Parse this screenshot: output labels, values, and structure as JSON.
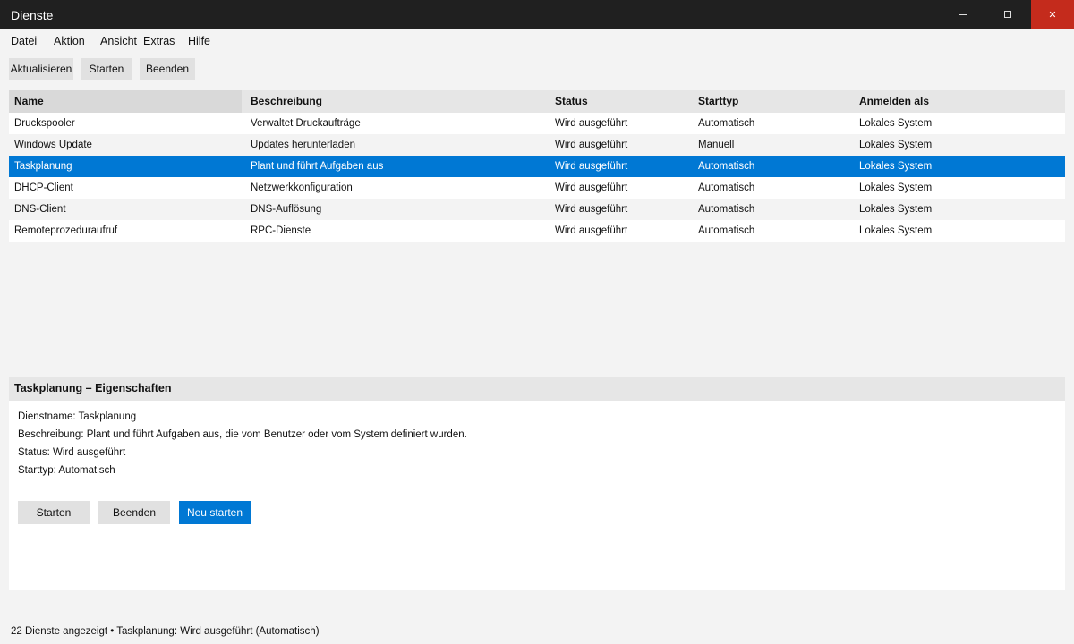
{
  "window": {
    "title": "Dienste",
    "minimize_icon": "minimize-icon",
    "maximize_icon": "maximize-icon",
    "close_glyph": "✕"
  },
  "menu": [
    "Datei",
    "Aktion",
    "Ansicht",
    "Extras",
    "Hilfe"
  ],
  "toolbar": {
    "refresh_label": "Aktualisieren",
    "start_label": "Starten",
    "stop_label": "Beenden"
  },
  "table": {
    "columns": [
      "Name",
      "Beschreibung",
      "Status",
      "Starttyp",
      "Anmelden als"
    ],
    "rows": [
      {
        "name": "Druckspooler",
        "description": "Verwaltet Druckaufträge",
        "status": "Wird ausgeführt",
        "start_type": "Automatisch",
        "logon": "Lokales System"
      },
      {
        "name": "Windows Update",
        "description": "Updates herunterladen",
        "status": "Wird ausgeführt",
        "start_type": "Manuell",
        "logon": "Lokales System"
      },
      {
        "name": "Taskplanung",
        "description": "Plant und führt Aufgaben aus",
        "status": "Wird ausgeführt",
        "start_type": "Automatisch",
        "logon": "Lokales System"
      },
      {
        "name": "DHCP-Client",
        "description": "Netzwerkkonfiguration",
        "status": "Wird ausgeführt",
        "start_type": "Automatisch",
        "logon": "Lokales System"
      },
      {
        "name": "DNS-Client",
        "description": "DNS-Auflösung",
        "status": "Wird ausgeführt",
        "start_type": "Automatisch",
        "logon": "Lokales System"
      },
      {
        "name": "Remoteprozeduraufruf",
        "description": "RPC-Dienste",
        "status": "Wird ausgeführt",
        "start_type": "Automatisch",
        "logon": "Lokales System"
      }
    ],
    "selected_row": "Taskplanung"
  },
  "properties": {
    "header": "Taskplanung – Eigenschaften",
    "service_name": "Dienstname: Taskplanung",
    "description": "Beschreibung: Plant und führt Aufgaben aus, die vom Benutzer oder vom System definiert wurden.",
    "status": "Status: Wird ausgeführt",
    "start_type": "Starttyp: Automatisch",
    "start_label": "Starten",
    "stop_label": "Beenden",
    "restart_label": "Neu starten"
  },
  "status_bar": "22 Dienste angezeigt • Taskplanung: Wird ausgeführt (Automatisch)",
  "colors": {
    "titlebar": "#202020",
    "close": "#c42b1c",
    "accent": "#0078d4",
    "background": "#f3f3f3"
  }
}
